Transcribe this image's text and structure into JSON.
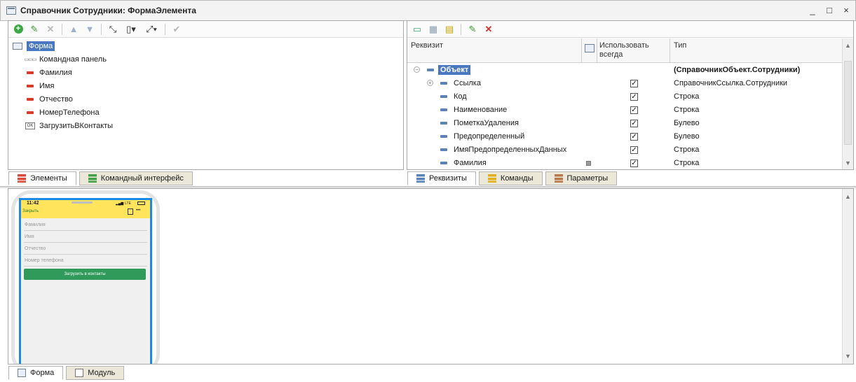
{
  "window": {
    "title": "Справочник Сотрудники: ФормаЭлемента",
    "controls": [
      "_",
      "□",
      "×"
    ]
  },
  "left_panel": {
    "toolbar_icons": [
      "add-icon",
      "edit-icon",
      "delete-icon",
      "move-up-icon",
      "move-down-icon",
      "move-icon",
      "add-group-icon",
      "expand-icon",
      "check-icon"
    ],
    "tree": [
      {
        "label": "Форма",
        "icon": "form-icon",
        "selected": true
      },
      {
        "label": "Командная панель",
        "icon": "command-panel-icon"
      },
      {
        "label": "Фамилия",
        "icon": "field-icon"
      },
      {
        "label": "Имя",
        "icon": "field-icon"
      },
      {
        "label": "Отчество",
        "icon": "field-icon"
      },
      {
        "label": "НомерТелефона",
        "icon": "field-icon"
      },
      {
        "label": "ЗагрузитьВКонтакты",
        "icon": "button-icon",
        "badge": "OK"
      }
    ],
    "tabs": [
      {
        "label": "Элементы",
        "active": true
      },
      {
        "label": "Командный интерфейс",
        "active": false
      }
    ]
  },
  "right_panel": {
    "toolbar_icons": [
      "add-attribute-icon",
      "add-table-icon",
      "add-column-icon",
      "edit-icon",
      "delete-icon"
    ],
    "headers": {
      "attribute": "Реквизит",
      "use_always": "Использовать всегда",
      "type": "Тип"
    },
    "rows": [
      {
        "name": "Объект",
        "type": "(СправочникОбъект.Сотрудники)",
        "checked": null,
        "root": true
      },
      {
        "name": "Ссылка",
        "type": "СправочникСсылка.Сотрудники",
        "checked": true,
        "expandable": true
      },
      {
        "name": "Код",
        "type": "Строка",
        "checked": true
      },
      {
        "name": "Наименование",
        "type": "Строка",
        "checked": true
      },
      {
        "name": "ПометкаУдаления",
        "type": "Булево",
        "checked": true
      },
      {
        "name": "Предопределенный",
        "type": "Булево",
        "checked": true
      },
      {
        "name": "ИмяПредопределенныхДанных",
        "type": "Строка",
        "checked": true
      },
      {
        "name": "Фамилия",
        "type": "Строка",
        "checked": true,
        "used_marker": true
      }
    ],
    "tabs": [
      {
        "label": "Реквизиты",
        "active": true
      },
      {
        "label": "Команды",
        "active": false
      },
      {
        "label": "Параметры",
        "active": false
      }
    ]
  },
  "preview": {
    "status_time": "11:42",
    "status_network": "LTE",
    "close_label": "Закрыть",
    "menu_dots": "•••",
    "fields": [
      "Фамилия",
      "Имя",
      "Отчество",
      "Номер телефона"
    ],
    "button_label": "Загрузить в контакты",
    "colors": {
      "header": "#ffe45c",
      "button": "#2f9a5a",
      "frame": "#1e88e5"
    }
  },
  "bottom_tabs": [
    {
      "label": "Форма",
      "active": true
    },
    {
      "label": "Модуль",
      "active": false
    }
  ]
}
